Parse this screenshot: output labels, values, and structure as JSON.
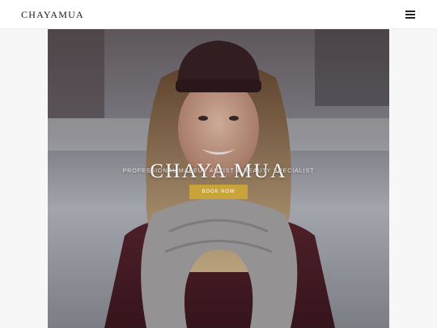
{
  "header": {
    "logo_text": "CHAYAMUA",
    "menu_icon": "hamburger-menu-icon"
  },
  "hero": {
    "title": "CHAYA MUA",
    "subtitle": "PROFESSIONAL MAKEUP ARTIST & BEAUTY SPECIALIST",
    "cta_label": "BOOK NOW",
    "cta_color": "#c9a43a"
  }
}
